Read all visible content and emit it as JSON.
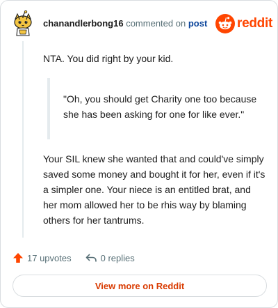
{
  "header": {
    "username": "chanandlerbong16",
    "action_text": "commented on",
    "post_link": "post",
    "brand": "reddit"
  },
  "comment": {
    "paragraph1": "NTA. You did right by your kid.",
    "quote": "\"Oh, you should get Charity one too because she has been asking for one for like ever.\"",
    "paragraph2": "Your SIL knew she wanted that and could've simply saved some money and bought it for her, even if it's a simpler one. Your niece is an entitled brat, and her mom allowed her to be rhis way by blaming others for her tantrums."
  },
  "footer": {
    "upvotes": "17 upvotes",
    "replies": "0 replies",
    "view_more": "View more on Reddit"
  },
  "colors": {
    "brand": "#ff4500",
    "upvote": "#ff4500",
    "link": "#0a449b",
    "view_more": "#d93a00"
  },
  "icons": {
    "avatar": "snoo-avatar-icon",
    "logo": "reddit-snoo-icon",
    "upvote": "upvote-arrow-icon",
    "reply": "reply-arrow-icon"
  }
}
